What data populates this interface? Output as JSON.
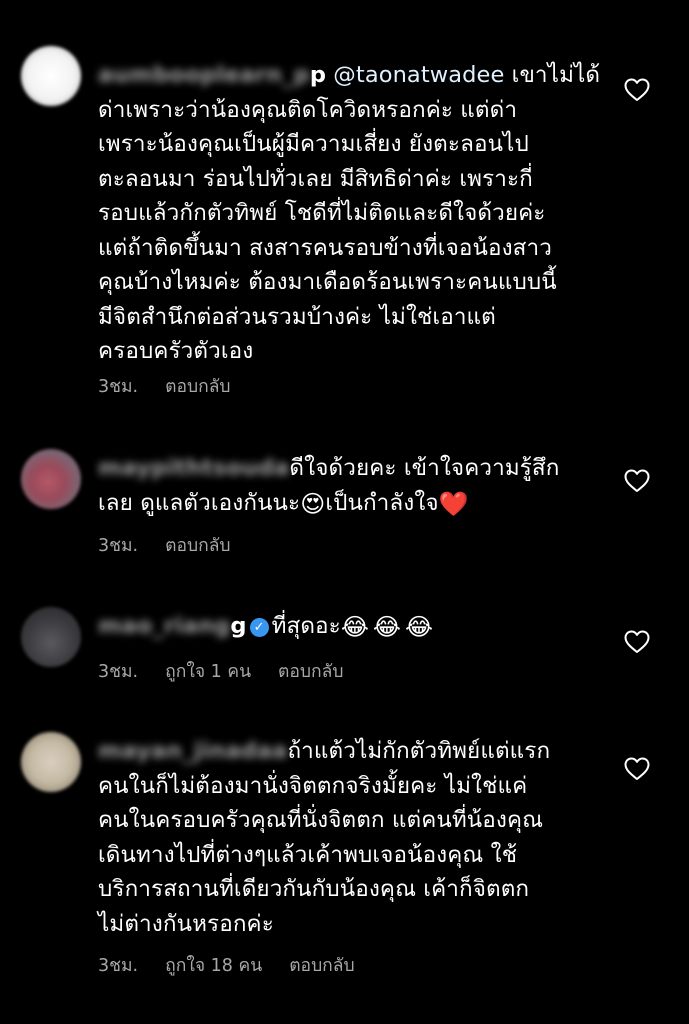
{
  "comments": [
    {
      "username": "aumbooplearn_p",
      "username_tail": "p",
      "mention": "@taonatwadee",
      "lines": [
        " เขาไม่ได้",
        "ด่าเพราะว่าน้องคุณติดโควิดหรอกค่ะ  แต่ด่า",
        "เพราะน้องคุณเป็นผู้มีความเสี่ยง ยังตะลอนไป",
        "ตะลอนมา ร่อนไปทั่วเลย มีสิทธิด่าค่ะ เพราะกี่",
        "รอบแล้วกักตัวทิพย์  โชดีที่ไม่ติดและดีใจด้วยค่ะ",
        "แต่ถ้าติดขึ้นมา สงสารคนรอบข้างที่เจอน้องสาว",
        "คุณบ้างไหมค่ะ ต้องมาเดือดร้อนเพราะคนแบบนี้",
        "มีจิตสำนึกต่อส่วนรวมบ้างค่ะ ไม่ใช่เอาแต่",
        "ครอบครัวตัวเอง"
      ],
      "time": "3ชม.",
      "reply": "ตอบกลับ",
      "icon": "heart-outline-icon"
    },
    {
      "username": "maypithtsouda",
      "line1": "ดีใจด้วยคะ  เข้าใจความรู้สึก",
      "line2_a": "เลย  ดูแลตัวเองกันนะ",
      "emoji_1": "😍",
      "line2_b": "เป็นกำลังใจ",
      "emoji_2": "❤️",
      "time": "3ชม.",
      "reply": "ตอบกลับ",
      "icon": "heart-outline-icon"
    },
    {
      "username": "mao_riang",
      "username_tail": "g",
      "verified": "✓",
      "text": "ที่สุดอะ",
      "emojis": "😂😂😂",
      "time": "3ชม.",
      "likes": "ถูกใจ 1 คน",
      "reply": "ตอบกลับ",
      "icon": "heart-outline-icon"
    },
    {
      "username": "mayan_jinadaa",
      "lines": [
        "ถ้าแต้วไม่กักตัวทิพย์แต่แรก",
        "คนในก็ไม่ต้องมานั่งจิตตกจริงมั้ยคะ ไม่ใช่แค่",
        "คนในครอบครัวคุณที่นั่งจิตตก แต่คนที่น้องคุณ",
        "เดินทางไปที่ต่างๆแล้วเค้าพบเจอน้องคุณ ใช้",
        "บริการสถานที่เดียวกันกับน้องคุณ เค้าก็จิตตก",
        "ไม่ต่างกันหรอกค่ะ"
      ],
      "time": "3ชม.",
      "likes": "ถูกใจ 18 คน",
      "reply": "ตอบกลับ",
      "icon": "heart-outline-icon"
    }
  ],
  "colors": {
    "background": "#000000",
    "text": "#ffffff",
    "meta": "#a8a8a8",
    "mention": "#e0f1ff",
    "verified": "#3897f0"
  }
}
